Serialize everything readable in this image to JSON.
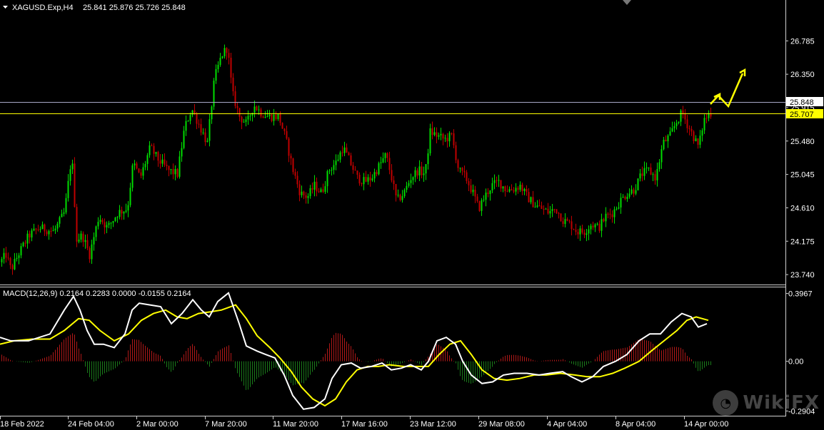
{
  "header": {
    "symbol": "XAGUSD.Exp,H4",
    "ohlc": "25.841 25.876 25.726 25.848"
  },
  "macd_header": "MACD(12,26,9) 0.2164 0.2283 0.0000 -0.0155 0.2164",
  "price_axis": [
    "26.785",
    "26.350",
    "25.915",
    "25.480",
    "25.045",
    "24.610",
    "24.175",
    "23.740"
  ],
  "macd_axis": [
    "0.3967",
    "0.00",
    "-0.2904"
  ],
  "time_axis": [
    "18 Feb 2022",
    "24 Feb 04:00",
    "2 Mar 00:00",
    "7 Mar 20:00",
    "11 Mar 20:00",
    "17 Mar 16:00",
    "23 Mar 12:00",
    "29 Mar 08:00",
    "4 Apr 04:00",
    "8 Apr 04:00",
    "14 Apr 00:00"
  ],
  "current_price": "25.848",
  "level_price": "25.707",
  "watermark": "WikiFX",
  "colors": {
    "bull": "#00dd00",
    "bear": "#c00000",
    "macd_line": "#ffffff",
    "signal_line": "#ffff00",
    "hist_pos": "#b01818",
    "hist_neg": "#1a7a1a",
    "level": "#ffff00",
    "bid": "#a8a8c8",
    "arrow": "#ffff00"
  },
  "chart_data": [
    {
      "type": "candlestick",
      "title": "XAGUSD.Exp,H4",
      "y_ticks": [
        26.785,
        26.35,
        25.915,
        25.48,
        25.045,
        24.61,
        24.175,
        23.74
      ],
      "ylim": [
        23.62,
        27.15
      ],
      "x_labels": [
        "18 Feb 2022",
        "24 Feb 04:00",
        "2 Mar 00:00",
        "7 Mar 20:00",
        "11 Mar 20:00",
        "17 Mar 16:00",
        "23 Mar 12:00",
        "29 Mar 08:00",
        "4 Apr 04:00",
        "8 Apr 04:00",
        "14 Apr 00:00"
      ],
      "close_path": [
        [
          0,
          23.9
        ],
        [
          8,
          24.0
        ],
        [
          15,
          23.8
        ],
        [
          25,
          24.0
        ],
        [
          40,
          24.25
        ],
        [
          55,
          24.35
        ],
        [
          75,
          24.3
        ],
        [
          90,
          24.55
        ],
        [
          100,
          25.3
        ],
        [
          107,
          24.2
        ],
        [
          115,
          24.25
        ],
        [
          125,
          24.0
        ],
        [
          138,
          24.5
        ],
        [
          150,
          24.35
        ],
        [
          165,
          24.55
        ],
        [
          178,
          24.6
        ],
        [
          186,
          25.2
        ],
        [
          196,
          25.0
        ],
        [
          210,
          25.4
        ],
        [
          220,
          25.25
        ],
        [
          235,
          25.1
        ],
        [
          248,
          25.05
        ],
        [
          258,
          25.65
        ],
        [
          268,
          25.9
        ],
        [
          278,
          25.7
        ],
        [
          290,
          25.45
        ],
        [
          300,
          26.3
        ],
        [
          310,
          26.6
        ],
        [
          318,
          26.7
        ],
        [
          325,
          26.1
        ],
        [
          335,
          25.8
        ],
        [
          345,
          25.7
        ],
        [
          355,
          25.95
        ],
        [
          365,
          25.85
        ],
        [
          375,
          25.8
        ],
        [
          390,
          25.8
        ],
        [
          400,
          25.5
        ],
        [
          410,
          25.1
        ],
        [
          420,
          24.8
        ],
        [
          430,
          24.75
        ],
        [
          440,
          24.9
        ],
        [
          450,
          24.8
        ],
        [
          460,
          25.1
        ],
        [
          470,
          25.2
        ],
        [
          480,
          25.4
        ],
        [
          490,
          25.2
        ],
        [
          500,
          25.0
        ],
        [
          510,
          24.95
        ],
        [
          520,
          25.0
        ],
        [
          530,
          25.15
        ],
        [
          540,
          25.3
        ],
        [
          548,
          25.0
        ],
        [
          555,
          24.7
        ],
        [
          565,
          24.8
        ],
        [
          575,
          25.0
        ],
        [
          585,
          25.1
        ],
        [
          595,
          25.05
        ],
        [
          602,
          25.6
        ],
        [
          612,
          25.55
        ],
        [
          622,
          25.5
        ],
        [
          632,
          25.55
        ],
        [
          642,
          25.1
        ],
        [
          652,
          25.0
        ],
        [
          662,
          24.8
        ],
        [
          670,
          24.6
        ],
        [
          678,
          24.75
        ],
        [
          688,
          24.9
        ],
        [
          698,
          24.95
        ],
        [
          708,
          24.85
        ],
        [
          718,
          24.85
        ],
        [
          728,
          24.9
        ],
        [
          738,
          24.75
        ],
        [
          748,
          24.65
        ],
        [
          758,
          24.6
        ],
        [
          768,
          24.55
        ],
        [
          778,
          24.6
        ],
        [
          788,
          24.45
        ],
        [
          798,
          24.4
        ],
        [
          808,
          24.3
        ],
        [
          818,
          24.3
        ],
        [
          828,
          24.4
        ],
        [
          838,
          24.35
        ],
        [
          848,
          24.5
        ],
        [
          858,
          24.55
        ],
        [
          868,
          24.7
        ],
        [
          878,
          24.8
        ],
        [
          888,
          24.85
        ],
        [
          898,
          25.05
        ],
        [
          908,
          25.1
        ],
        [
          918,
          25.0
        ],
        [
          928,
          25.45
        ],
        [
          938,
          25.55
        ],
        [
          948,
          25.75
        ],
        [
          955,
          25.85
        ],
        [
          962,
          25.7
        ],
        [
          970,
          25.55
        ],
        [
          978,
          25.4
        ],
        [
          985,
          25.75
        ],
        [
          995,
          25.85
        ]
      ],
      "current_price": 25.848,
      "level": 25.707
    },
    {
      "type": "line",
      "title": "MACD(12,26,9)",
      "y_ticks": [
        0.3967,
        0.0,
        -0.2904
      ],
      "ylim": [
        -0.31,
        0.42
      ],
      "series": [
        {
          "name": "MACD",
          "points": [
            [
              0,
              0.14
            ],
            [
              15,
              0.12
            ],
            [
              40,
              0.12
            ],
            [
              70,
              0.16
            ],
            [
              90,
              0.3
            ],
            [
              103,
              0.38
            ],
            [
              112,
              0.3
            ],
            [
              122,
              0.18
            ],
            [
              132,
              0.1
            ],
            [
              145,
              0.1
            ],
            [
              160,
              0.08
            ],
            [
              175,
              0.16
            ],
            [
              185,
              0.3
            ],
            [
              195,
              0.34
            ],
            [
              210,
              0.33
            ],
            [
              225,
              0.32
            ],
            [
              240,
              0.22
            ],
            [
              255,
              0.28
            ],
            [
              270,
              0.36
            ],
            [
              282,
              0.3
            ],
            [
              293,
              0.26
            ],
            [
              305,
              0.35
            ],
            [
              320,
              0.4
            ],
            [
              335,
              0.22
            ],
            [
              345,
              0.09
            ],
            [
              360,
              0.06
            ],
            [
              372,
              0.04
            ],
            [
              385,
              0.02
            ],
            [
              398,
              -0.08
            ],
            [
              410,
              -0.2
            ],
            [
              425,
              -0.28
            ],
            [
              440,
              -0.27
            ],
            [
              455,
              -0.22
            ],
            [
              465,
              -0.1
            ],
            [
              478,
              -0.02
            ],
            [
              492,
              -0.01
            ],
            [
              505,
              -0.04
            ],
            [
              520,
              -0.03
            ],
            [
              535,
              -0.01
            ],
            [
              548,
              -0.05
            ],
            [
              562,
              -0.04
            ],
            [
              575,
              -0.02
            ],
            [
              590,
              -0.05
            ],
            [
              600,
              0.0
            ],
            [
              612,
              0.12
            ],
            [
              625,
              0.14
            ],
            [
              638,
              0.1
            ],
            [
              648,
              0.0
            ],
            [
              660,
              -0.08
            ],
            [
              675,
              -0.13
            ],
            [
              690,
              -0.12
            ],
            [
              705,
              -0.08
            ],
            [
              720,
              -0.07
            ],
            [
              738,
              -0.07
            ],
            [
              755,
              -0.08
            ],
            [
              770,
              -0.07
            ],
            [
              788,
              -0.06
            ],
            [
              800,
              -0.09
            ],
            [
              815,
              -0.12
            ],
            [
              830,
              -0.09
            ],
            [
              845,
              -0.03
            ],
            [
              862,
              0.0
            ],
            [
              878,
              0.04
            ],
            [
              895,
              0.12
            ],
            [
              910,
              0.16
            ],
            [
              925,
              0.16
            ],
            [
              940,
              0.23
            ],
            [
              955,
              0.28
            ],
            [
              968,
              0.26
            ],
            [
              978,
              0.2
            ],
            [
              990,
              0.22
            ]
          ]
        },
        {
          "name": "Signal",
          "points": [
            [
              0,
              0.1
            ],
            [
              20,
              0.12
            ],
            [
              45,
              0.13
            ],
            [
              70,
              0.13
            ],
            [
              90,
              0.18
            ],
            [
              110,
              0.25
            ],
            [
              125,
              0.24
            ],
            [
              140,
              0.18
            ],
            [
              160,
              0.12
            ],
            [
              180,
              0.16
            ],
            [
              198,
              0.24
            ],
            [
              215,
              0.28
            ],
            [
              232,
              0.3
            ],
            [
              248,
              0.26
            ],
            [
              262,
              0.25
            ],
            [
              278,
              0.28
            ],
            [
              295,
              0.29
            ],
            [
              310,
              0.3
            ],
            [
              330,
              0.33
            ],
            [
              345,
              0.25
            ],
            [
              360,
              0.15
            ],
            [
              378,
              0.08
            ],
            [
              392,
              0.02
            ],
            [
              408,
              -0.06
            ],
            [
              422,
              -0.15
            ],
            [
              438,
              -0.22
            ],
            [
              455,
              -0.26
            ],
            [
              470,
              -0.22
            ],
            [
              485,
              -0.12
            ],
            [
              500,
              -0.05
            ],
            [
              515,
              -0.03
            ],
            [
              530,
              -0.03
            ],
            [
              545,
              -0.02
            ],
            [
              565,
              -0.03
            ],
            [
              585,
              -0.03
            ],
            [
              600,
              -0.03
            ],
            [
              615,
              0.04
            ],
            [
              630,
              0.1
            ],
            [
              645,
              0.12
            ],
            [
              660,
              0.04
            ],
            [
              675,
              -0.05
            ],
            [
              692,
              -0.1
            ],
            [
              710,
              -0.11
            ],
            [
              728,
              -0.1
            ],
            [
              748,
              -0.08
            ],
            [
              765,
              -0.08
            ],
            [
              785,
              -0.07
            ],
            [
              805,
              -0.08
            ],
            [
              822,
              -0.09
            ],
            [
              840,
              -0.09
            ],
            [
              858,
              -0.07
            ],
            [
              875,
              -0.04
            ],
            [
              895,
              0.0
            ],
            [
              912,
              0.06
            ],
            [
              930,
              0.12
            ],
            [
              948,
              0.18
            ],
            [
              962,
              0.24
            ],
            [
              975,
              0.26
            ],
            [
              992,
              0.24
            ]
          ]
        }
      ]
    }
  ]
}
